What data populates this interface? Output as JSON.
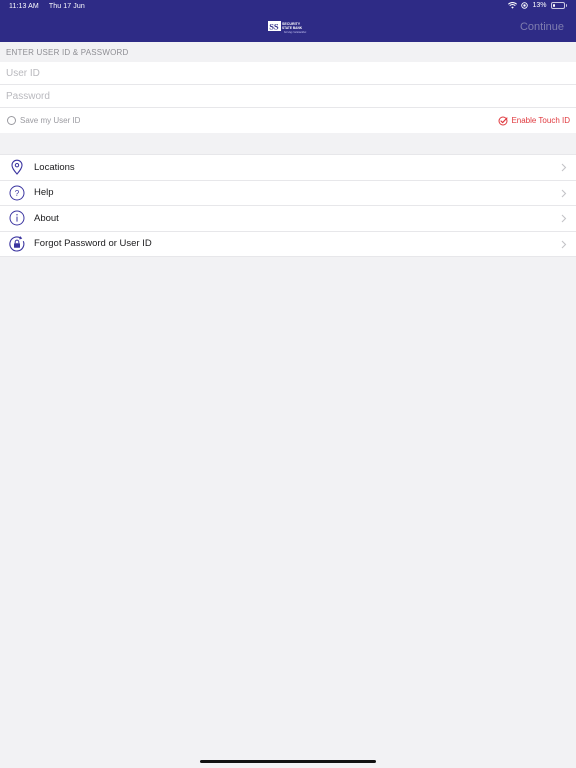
{
  "status_bar": {
    "time": "11:13 AM",
    "date": "Thu 17 Jun",
    "battery": "13%"
  },
  "header": {
    "logo_text": "SECURITY STATE BANK",
    "logo_tagline": "Serving Communities",
    "continue_label": "Continue"
  },
  "login": {
    "section_title": "ENTER USER ID & PASSWORD",
    "user_id_placeholder": "User ID",
    "password_placeholder": "Password",
    "save_user_id_label": "Save my User ID",
    "enable_touch_id_label": "Enable Touch ID"
  },
  "menu": {
    "items": [
      {
        "label": "Locations",
        "icon": "location-pin-icon"
      },
      {
        "label": "Help",
        "icon": "question-circle-icon"
      },
      {
        "label": "About",
        "icon": "info-circle-icon"
      },
      {
        "label": "Forgot Password or User ID",
        "icon": "lock-reset-icon"
      }
    ]
  },
  "colors": {
    "header_bg": "#2e2b86",
    "accent": "#3b35a0",
    "touch_id_red": "#e0393e"
  }
}
